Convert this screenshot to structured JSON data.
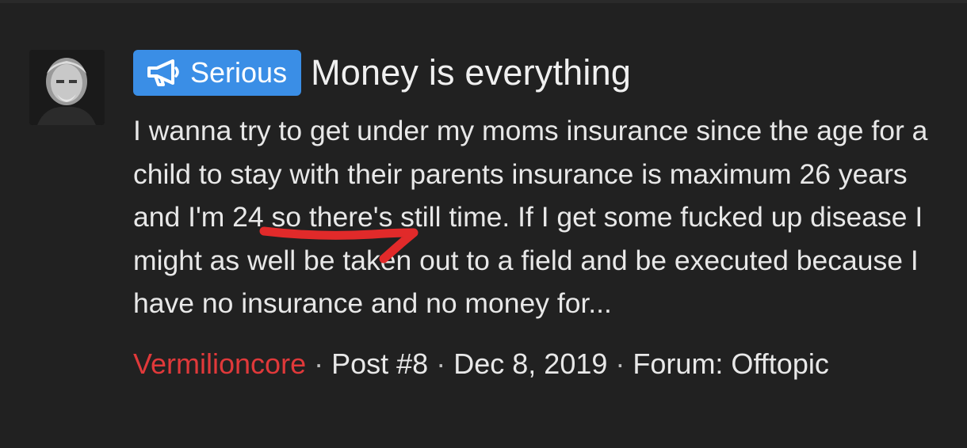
{
  "thread": {
    "prefix": "Serious",
    "prefix_icon": "megaphone-icon",
    "title": "Money is everything",
    "snippet": "I wanna try to get under my moms insurance since the age for a child to stay with their parents insurance is maximum 26 years and I'm 24 so there's still time. If I get some fucked up disease I might as well be taken out to a field and be executed because I have no insurance and no money for...",
    "author": "Vermilioncore",
    "post_number": "Post #8",
    "date": "Dec 8, 2019",
    "forum": "Forum: Offtopic",
    "separator": "·"
  },
  "colors": {
    "background": "#212121",
    "prefix_badge": "#3a8ee6",
    "author": "#e0393a",
    "annotation": "#e12a2a"
  }
}
